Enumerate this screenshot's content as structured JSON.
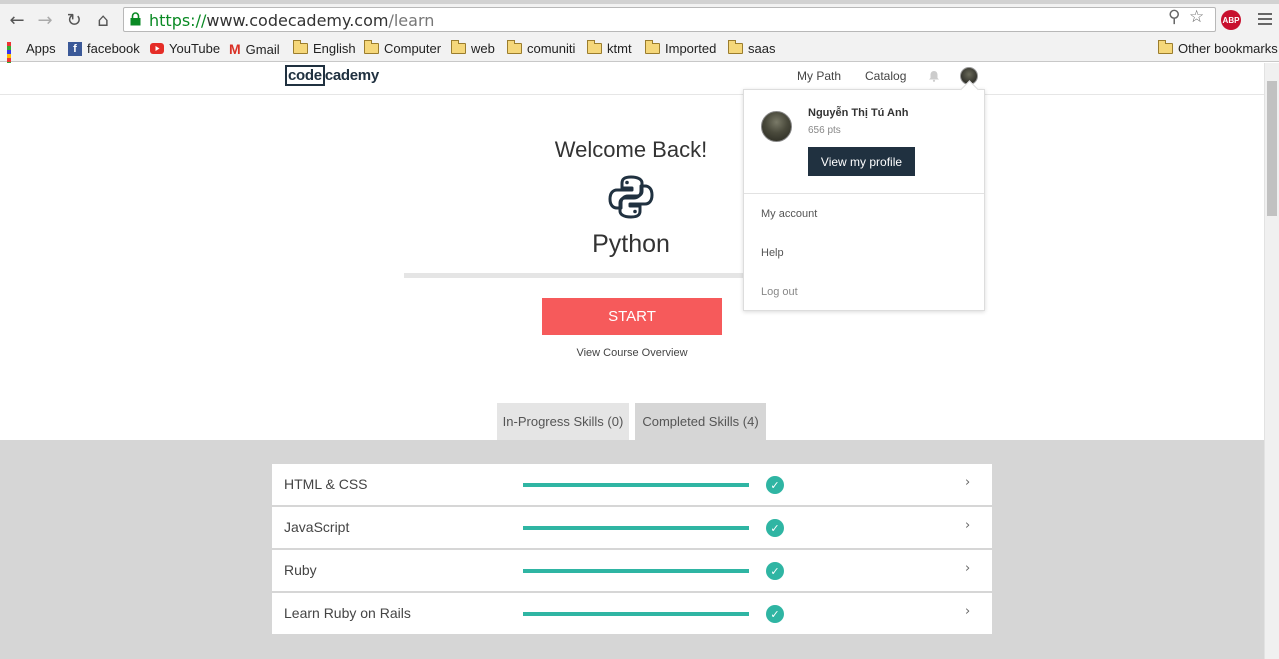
{
  "browser": {
    "url_scheme": "https://",
    "url_host": "www.codecademy.com",
    "url_path": "/learn",
    "abp_label": "ABP",
    "bookmarks": [
      {
        "label": "Apps",
        "icon": "apps-grid-icon"
      },
      {
        "label": "facebook",
        "icon": "facebook-icon"
      },
      {
        "label": "YouTube",
        "icon": "youtube-icon"
      },
      {
        "label": "Gmail",
        "icon": "gmail-icon"
      },
      {
        "label": "English",
        "icon": "folder-icon"
      },
      {
        "label": "Computer",
        "icon": "folder-icon"
      },
      {
        "label": "web",
        "icon": "folder-icon"
      },
      {
        "label": "comuniti",
        "icon": "folder-icon"
      },
      {
        "label": "ktmt",
        "icon": "folder-icon"
      },
      {
        "label": "Imported",
        "icon": "folder-icon"
      },
      {
        "label": "saas",
        "icon": "folder-icon"
      }
    ],
    "other_bookmarks": "Other bookmarks"
  },
  "header": {
    "logo_boxed": "code",
    "logo_rest": "cademy",
    "nav": [
      "My Path",
      "Catalog"
    ]
  },
  "main": {
    "welcome": "Welcome Back!",
    "course": "Python",
    "course_icon": "python-logo-icon",
    "start_label": "START",
    "overview_label": "View Course Overview",
    "tabs": [
      "In-Progress Skills (0)",
      "Completed Skills (4)"
    ],
    "skills": [
      {
        "name": "HTML & CSS",
        "progress": 1.0
      },
      {
        "name": "JavaScript",
        "progress": 1.0
      },
      {
        "name": "Ruby",
        "progress": 1.0
      },
      {
        "name": "Learn Ruby on Rails",
        "progress": 1.0
      }
    ]
  },
  "dropdown": {
    "name": "Nguyễn Thị Tú Anh",
    "points": "656 pts",
    "profile_button": "View my profile",
    "links": [
      "My account",
      "Help",
      "Log out"
    ]
  },
  "colors": {
    "accent_red": "#f65a5b",
    "navy": "#203140",
    "teal": "#2fb5a3"
  }
}
